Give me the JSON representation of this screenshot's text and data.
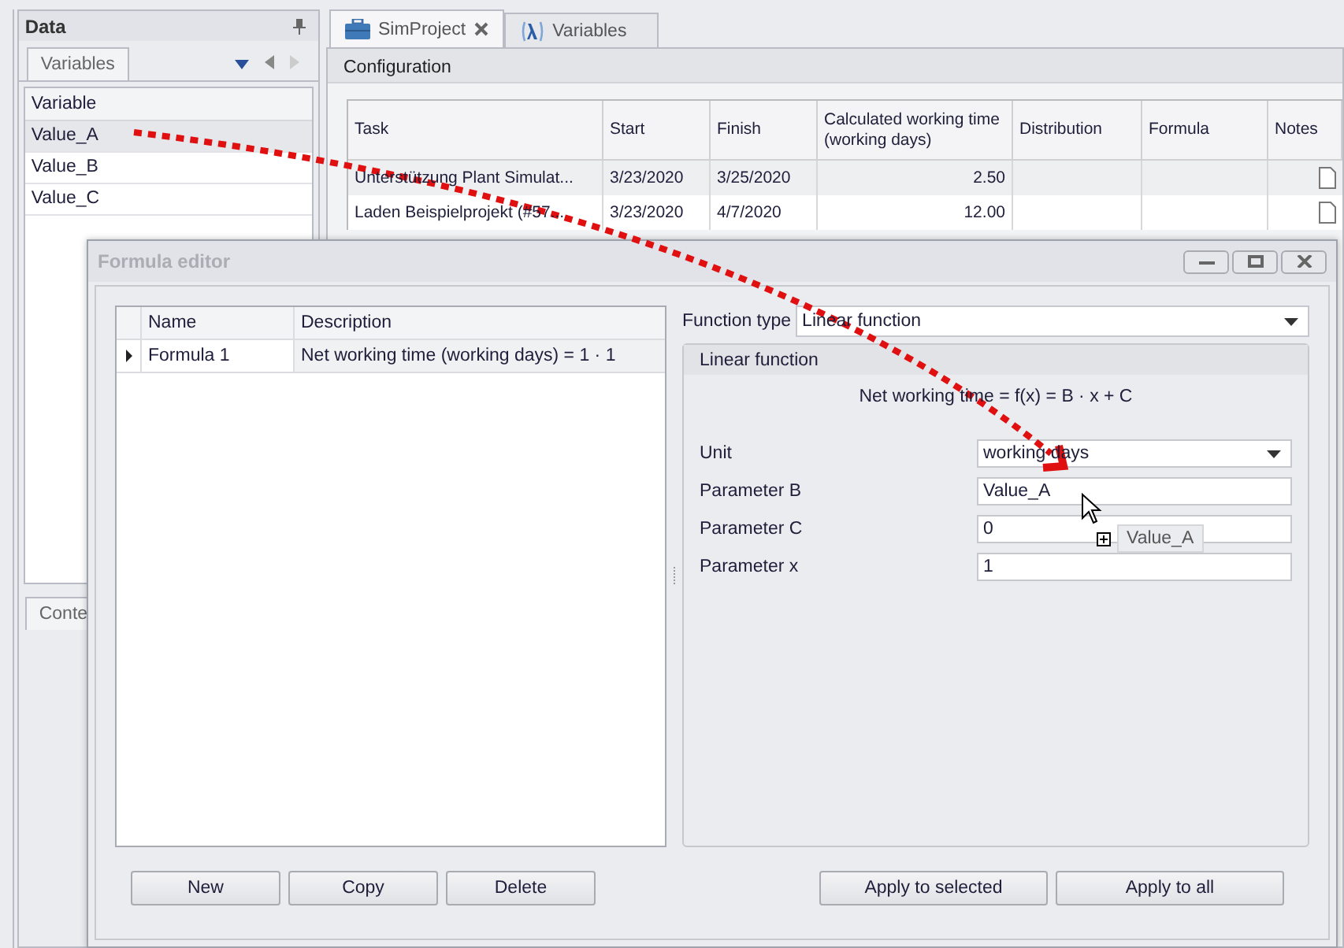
{
  "data_panel": {
    "title": "Data",
    "tabs": [
      {
        "label": "Variables",
        "selected": true
      }
    ],
    "grid": {
      "column": "Variable",
      "rows": [
        {
          "value": "Value_A",
          "selected": true
        },
        {
          "value": "Value_B",
          "selected": false
        },
        {
          "value": "Value_C",
          "selected": false
        }
      ]
    },
    "bottom_tab": "Conte"
  },
  "document_tabs": [
    {
      "label": "SimProject",
      "selected": true,
      "closable": true
    },
    {
      "label": "Variables",
      "selected": false,
      "closable": false
    }
  ],
  "configuration": {
    "title": "Configuration",
    "columns": [
      "Task",
      "Start",
      "Finish",
      "Calculated working time (working days)",
      "Distribution",
      "Formula",
      "Notes"
    ],
    "rows": [
      {
        "task": "Unterstützung Plant Simulat...",
        "start": "3/23/2020",
        "finish": "3/25/2020",
        "time": "2.50",
        "selected": true
      },
      {
        "task": "Laden Beispielprojekt (#57...",
        "start": "3/23/2020",
        "finish": "4/7/2020",
        "time": "12.00",
        "selected": false
      }
    ]
  },
  "formula_editor": {
    "title": "Formula editor",
    "active": false,
    "grid": {
      "columns": [
        "Name",
        "Description"
      ],
      "rows": [
        {
          "name": "Formula 1",
          "description": "Net working time (working days) = 1 · 1",
          "selected": true
        }
      ]
    },
    "function_type": {
      "label": "Function type",
      "value": "Linear function"
    },
    "group": {
      "title": "Linear function",
      "formula": "Net working time = f(x) = B · x + C",
      "fields": [
        {
          "kind": "combo",
          "label": "Unit",
          "value": "working days"
        },
        {
          "kind": "text",
          "label": "Parameter B",
          "value": "Value_A"
        },
        {
          "kind": "text",
          "label": "Parameter C",
          "value": "0"
        },
        {
          "kind": "text",
          "label": "Parameter x",
          "value": "1"
        }
      ]
    },
    "left_buttons": [
      "New",
      "Copy",
      "Delete"
    ],
    "right_buttons": [
      "Apply to selected",
      "Apply to all"
    ]
  },
  "drag_preview": {
    "label": "Value_A"
  }
}
